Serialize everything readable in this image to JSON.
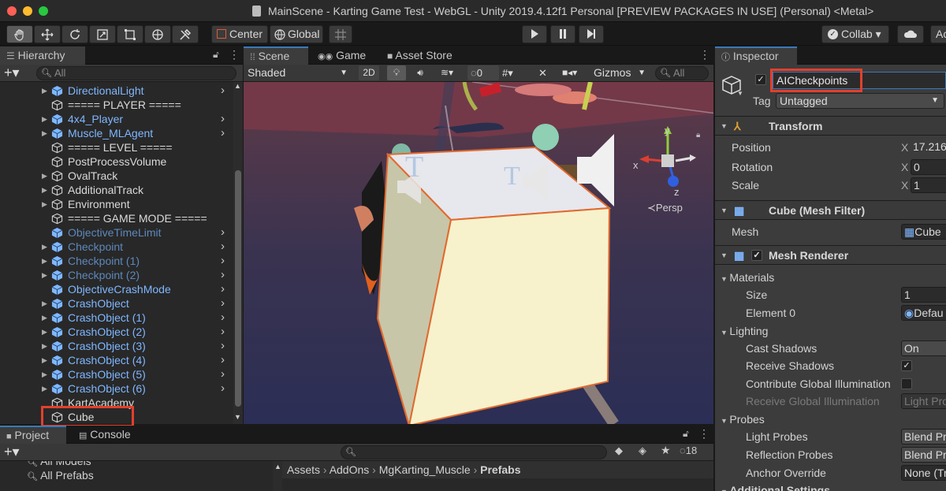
{
  "window": {
    "title": "MainScene - Karting Game Test - WebGL - Unity 2019.4.12f1 Personal [PREVIEW PACKAGES IN USE] (Personal) <Metal>"
  },
  "toolbar": {
    "center_label": "Center",
    "global_label": "Global",
    "collab_label": "Collab ▾",
    "account_label": "Ac"
  },
  "hierarchy": {
    "tab_label": "Hierarchy",
    "search_placeholder": "All",
    "items": [
      {
        "label": "DirectionalLight",
        "color": "blue",
        "arrow": true,
        "chevron": true,
        "prefab": true
      },
      {
        "label": "===== PLAYER =====",
        "color": "white",
        "arrow": false,
        "chevron": false,
        "prefab": false
      },
      {
        "label": "4x4_Player",
        "color": "blue",
        "arrow": true,
        "chevron": true,
        "prefab": true
      },
      {
        "label": "Muscle_MLAgent",
        "color": "blue",
        "arrow": true,
        "chevron": true,
        "prefab": true
      },
      {
        "label": "===== LEVEL =====",
        "color": "white",
        "arrow": false,
        "chevron": false,
        "prefab": false
      },
      {
        "label": "PostProcessVolume",
        "color": "white",
        "arrow": false,
        "chevron": false,
        "prefab": false
      },
      {
        "label": "OvalTrack",
        "color": "white",
        "arrow": true,
        "chevron": false,
        "prefab": false
      },
      {
        "label": "AdditionalTrack",
        "color": "white",
        "arrow": true,
        "chevron": false,
        "prefab": false
      },
      {
        "label": "Environment",
        "color": "white",
        "arrow": true,
        "chevron": false,
        "prefab": false
      },
      {
        "label": "===== GAME MODE =====",
        "color": "white",
        "arrow": false,
        "chevron": false,
        "prefab": false
      },
      {
        "label": "ObjectiveTimeLimit",
        "color": "dim",
        "arrow": false,
        "chevron": true,
        "prefab": true
      },
      {
        "label": "Checkpoint",
        "color": "dim",
        "arrow": true,
        "chevron": true,
        "prefab": true
      },
      {
        "label": "Checkpoint (1)",
        "color": "dim",
        "arrow": true,
        "chevron": true,
        "prefab": true
      },
      {
        "label": "Checkpoint (2)",
        "color": "dim",
        "arrow": true,
        "chevron": true,
        "prefab": true
      },
      {
        "label": "ObjectiveCrashMode",
        "color": "blue",
        "arrow": false,
        "chevron": true,
        "prefab": true
      },
      {
        "label": "CrashObject",
        "color": "blue",
        "arrow": true,
        "chevron": true,
        "prefab": true
      },
      {
        "label": "CrashObject (1)",
        "color": "blue",
        "arrow": true,
        "chevron": true,
        "prefab": true
      },
      {
        "label": "CrashObject (2)",
        "color": "blue",
        "arrow": true,
        "chevron": true,
        "prefab": true
      },
      {
        "label": "CrashObject (3)",
        "color": "blue",
        "arrow": true,
        "chevron": true,
        "prefab": true
      },
      {
        "label": "CrashObject (4)",
        "color": "blue",
        "arrow": true,
        "chevron": true,
        "prefab": true
      },
      {
        "label": "CrashObject (5)",
        "color": "blue",
        "arrow": true,
        "chevron": true,
        "prefab": true
      },
      {
        "label": "CrashObject (6)",
        "color": "blue",
        "arrow": true,
        "chevron": true,
        "prefab": true
      },
      {
        "label": "KartAcademy",
        "color": "white",
        "arrow": false,
        "chevron": false,
        "prefab": false
      },
      {
        "label": "Cube",
        "color": "white",
        "arrow": false,
        "chevron": false,
        "prefab": false
      }
    ]
  },
  "scene": {
    "tabs": [
      "Scene",
      "Game",
      "Asset Store"
    ],
    "shading_mode": "Shaded",
    "mode_2d": "2D",
    "hidden_count": "0",
    "gizmos_label": "Gizmos",
    "search_placeholder": "All",
    "persp_label": "Persp",
    "axis_x": "x",
    "axis_y": "y",
    "axis_z": "z"
  },
  "bottom": {
    "tabs": [
      "Project",
      "Console"
    ],
    "favorites": [
      "All Models",
      "All Prefabs"
    ],
    "breadcrumb": [
      "Assets",
      "AddOns",
      "MgKarting_Muscle",
      "Prefabs"
    ],
    "hidden_count": "18"
  },
  "inspector": {
    "tab_label": "Inspector",
    "object_name": "AICheckpoints",
    "tag_label": "Tag",
    "tag_value": "Untagged",
    "transform": {
      "title": "Transform",
      "position_label": "Position",
      "position_x": "17.216",
      "rotation_label": "Rotation",
      "rotation_x": "0",
      "scale_label": "Scale",
      "scale_x": "1",
      "x_label": "X"
    },
    "mesh_filter": {
      "title": "Cube (Mesh Filter)",
      "mesh_label": "Mesh",
      "mesh_value": "Cube"
    },
    "mesh_renderer": {
      "title": "Mesh Renderer",
      "materials_label": "Materials",
      "size_label": "Size",
      "size_value": "1",
      "element0_label": "Element 0",
      "element0_value": "Defau",
      "lighting_label": "Lighting",
      "cast_shadows_label": "Cast Shadows",
      "cast_shadows_value": "On",
      "receive_shadows_label": "Receive Shadows",
      "contribute_gi_label": "Contribute Global Illumination",
      "receive_gi_label": "Receive Global Illumination",
      "receive_gi_value": "Light Pro",
      "probes_label": "Probes",
      "light_probes_label": "Light Probes",
      "light_probes_value": "Blend Pr",
      "reflection_probes_label": "Reflection Probes",
      "reflection_probes_value": "Blend Pr",
      "anchor_override_label": "Anchor Override",
      "anchor_override_value": "None (Tr"
    },
    "additional_settings_label": "Additional Settings"
  },
  "colors": {
    "highlight": "#e2402d",
    "prefab_blue": "#7fb7ff",
    "tab_accent": "#3a79bb"
  }
}
